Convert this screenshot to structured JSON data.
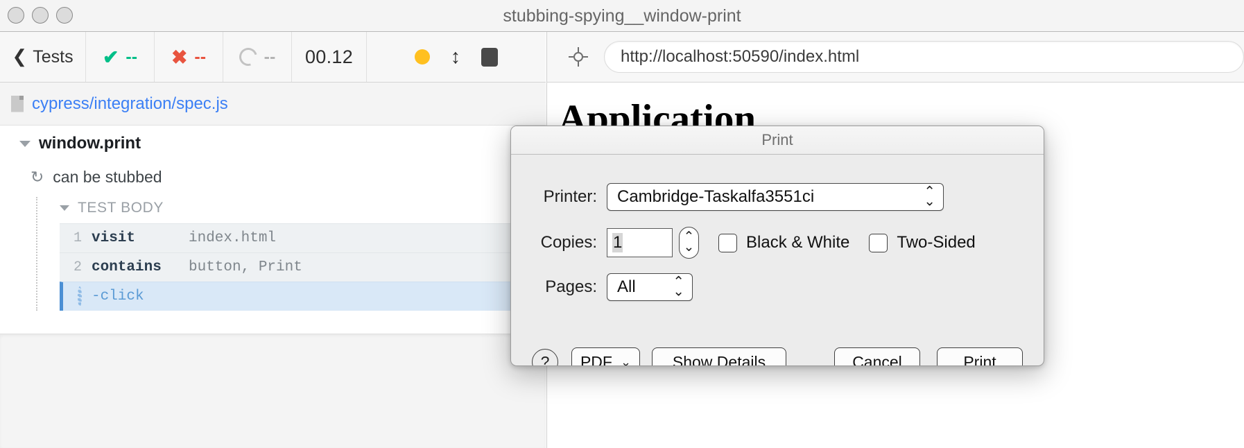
{
  "window": {
    "title": "stubbing-spying__window-print",
    "traffic_lights": [
      "close-button",
      "minimize-button",
      "zoom-button"
    ]
  },
  "runner_toolbar": {
    "back_label": "Tests",
    "back_icon": "chevron-left-icon",
    "passed_icon": "check-icon",
    "passed_count": "--",
    "failed_icon": "x-icon",
    "failed_count": "--",
    "pending_icon": "circle-outline-icon",
    "pending_count": "--",
    "duration": "00.12",
    "controls": {
      "dot_icon": "amber-dot-icon",
      "resize_icon": "vertical-resize-icon",
      "stop_icon": "stop-square-icon"
    }
  },
  "spec": {
    "file_icon": "file-icon",
    "path": "cypress/integration/spec.js"
  },
  "tree": {
    "suite": {
      "caret_icon": "caret-down-icon",
      "label": "window.print"
    },
    "test": {
      "retry_icon": "retry-icon",
      "label": "can be stubbed"
    },
    "body_header": {
      "caret_icon": "caret-down-icon",
      "label": "TEST BODY"
    },
    "commands": [
      {
        "num": "1",
        "name": "visit",
        "args": "index.html",
        "state": "done"
      },
      {
        "num": "2",
        "name": "contains",
        "args": "button, Print",
        "state": "done"
      },
      {
        "num": "",
        "name": "-click",
        "args": "",
        "state": "running",
        "icon": "spinner-icon"
      }
    ]
  },
  "aut": {
    "selector_icon": "selector-playground-icon",
    "url": "http://localhost:50590/index.html",
    "heading": "Application"
  },
  "print_dialog": {
    "title": "Print",
    "printer": {
      "label": "Printer:",
      "value": "Cambridge-Taskalfa3551ci",
      "stepper_icon": "up-down-chevrons-icon"
    },
    "copies": {
      "label": "Copies:",
      "value": "1",
      "stepper_icon": "up-down-chevrons-icon"
    },
    "checkboxes": [
      {
        "label": "Black & White",
        "checked": false
      },
      {
        "label": "Two-Sided",
        "checked": false
      }
    ],
    "pages": {
      "label": "Pages:",
      "value": "All",
      "stepper_icon": "up-down-chevrons-icon"
    },
    "buttons": {
      "help": "?",
      "pdf": "PDF",
      "pdf_caret_icon": "chevron-down-icon",
      "show_details": "Show Details",
      "cancel": "Cancel",
      "print": "Print"
    }
  },
  "colors": {
    "accent_blue": "#3b7ff5",
    "pass_green": "#00bf88",
    "fail_red": "#e8543f",
    "amber": "#ffc020",
    "active_row": "#d9e8f7"
  }
}
